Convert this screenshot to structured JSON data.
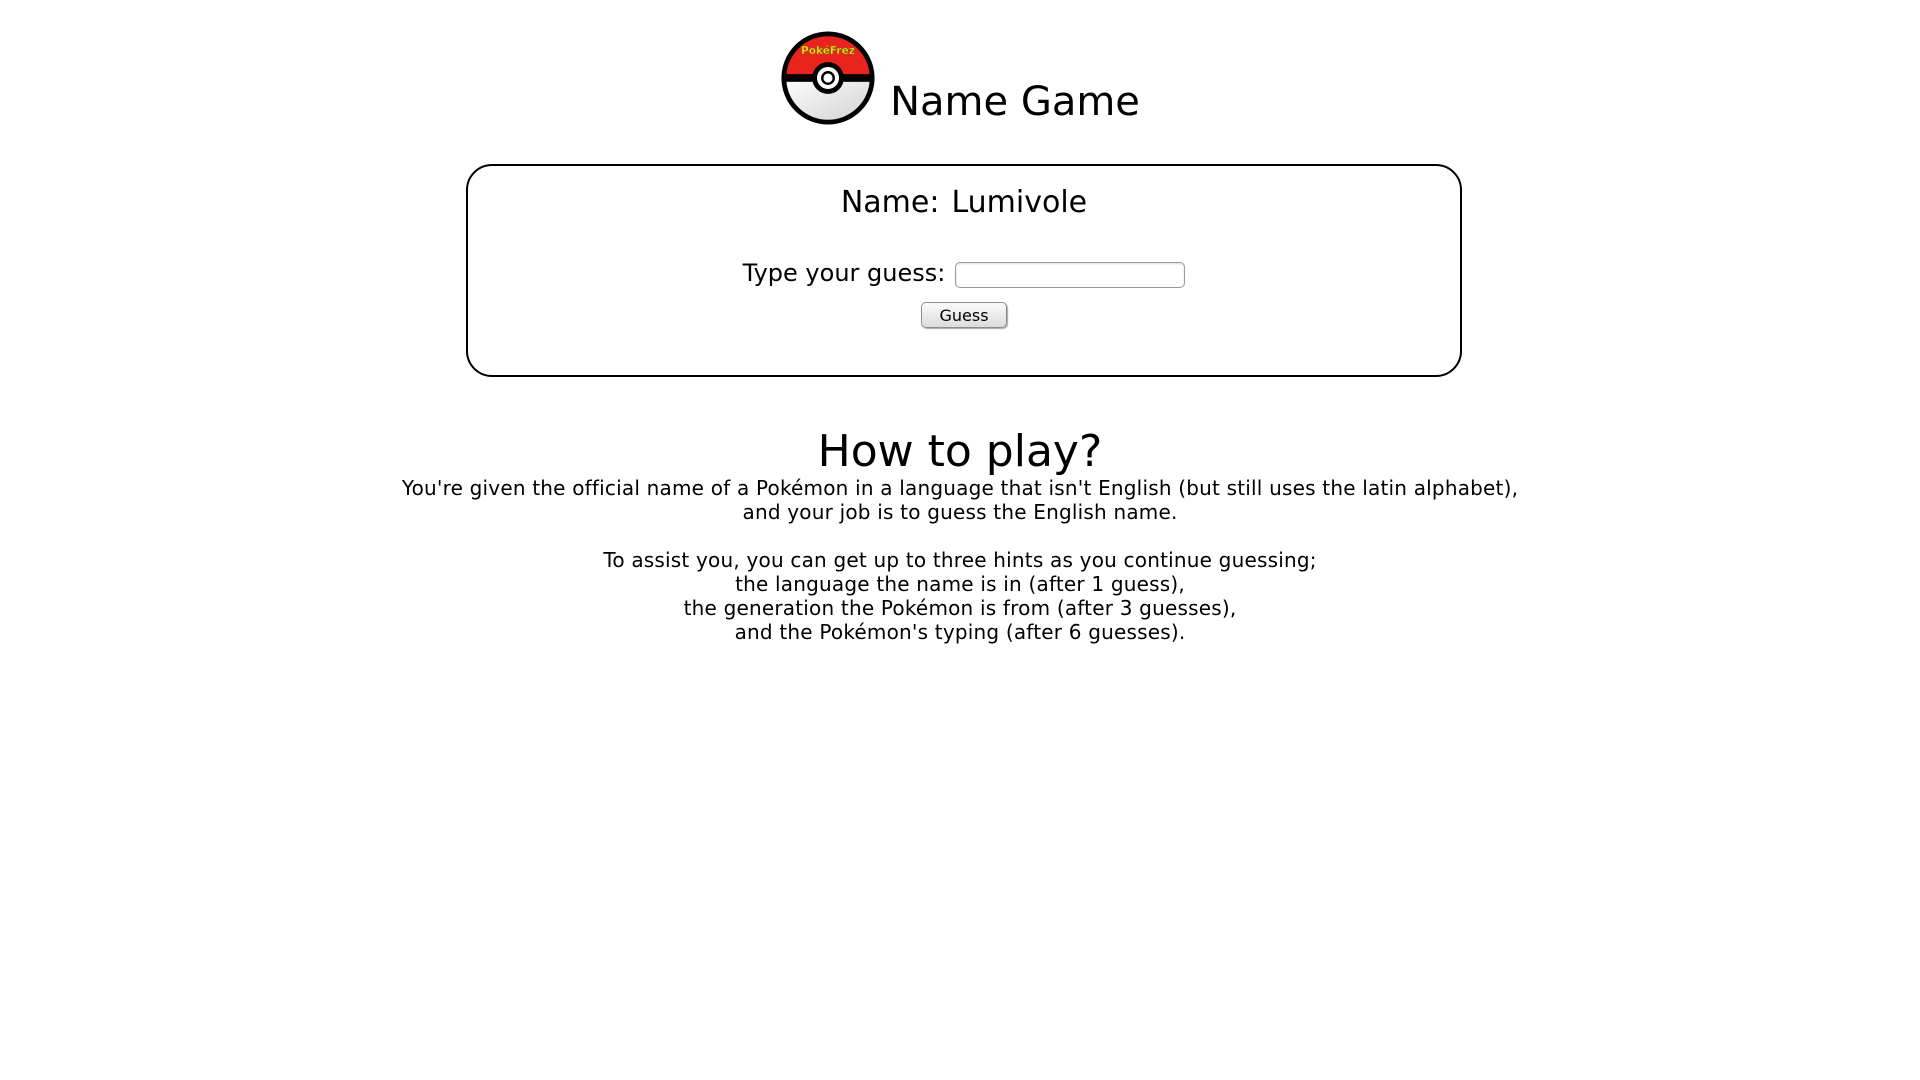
{
  "header": {
    "logo_text": "PokéFrez",
    "title": "Name Game"
  },
  "game": {
    "name_label": "Name:",
    "name_value": "Lumivole",
    "guess_label": "Type your guess:",
    "guess_value": "",
    "guess_placeholder": "",
    "guess_button": "Guess"
  },
  "instructions": {
    "title": "How to play?",
    "paragraph1": [
      "You're given the official name of a Pokémon in a language that isn't English (but still uses the latin alphabet),",
      "and your job is to guess the English name."
    ],
    "paragraph2": [
      "To assist you, you can get up to three hints as you continue guessing;",
      "the language the name is in (after 1 guess),",
      "the generation the Pokémon is from (after 3 guesses),",
      "and the Pokémon's typing (after 6 guesses)."
    ]
  },
  "colors": {
    "pokeball_top": "#e8241c",
    "pokeball_bottom": "#ffffff",
    "logo_text": "#f2e81c",
    "border": "#000000"
  },
  "icons": {
    "logo": "pokeball-icon"
  }
}
